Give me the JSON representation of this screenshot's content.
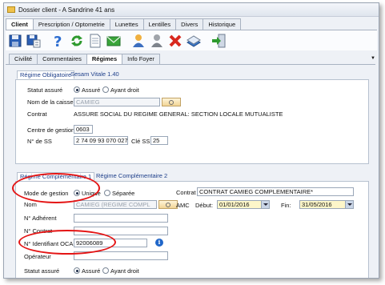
{
  "window": {
    "title": "Dossier client - A Sandrine 41 ans"
  },
  "main_tabs": [
    "Client",
    "Prescription / Optometrie",
    "Lunettes",
    "Lentilles",
    "Divers",
    "Historique"
  ],
  "toolbar": {
    "icons": [
      "save-icon",
      "save-as-icon",
      "help-icon",
      "refresh-icon",
      "document-icon",
      "email-icon",
      "user-icon",
      "user-grey-icon",
      "delete-icon",
      "book-icon",
      "exit-icon"
    ]
  },
  "sub_tabs": [
    "Civilité",
    "Commentaires",
    "Régimes",
    "Info Foyer"
  ],
  "panel1": {
    "tabs": [
      "Régime Obligatoire",
      "Sesam Vitale 1.40"
    ],
    "statut_label": "Statut assuré",
    "statut_options": [
      "Assuré",
      "Ayant droit"
    ],
    "caisse_label": "Nom de la caisse",
    "caisse_value": "CAMIEG",
    "contrat_label": "Contrat",
    "contrat_value": "ASSURE SOCIAL DU REGIME GENERAL: SECTION LOCALE MUTUALISTE",
    "centre_label": "Centre de gestion",
    "centre_value": "0603",
    "ss_label": "N° de SS",
    "ss_value": "2 74 09 93 070 027",
    "cle_label": "Clé SS",
    "cle_value": "25"
  },
  "panel2": {
    "tabs": [
      "Régime Complémentaire 1",
      "Régime Complémentaire 2"
    ],
    "mode_label": "Mode de gestion",
    "mode_options": [
      "Unique",
      "Séparée"
    ],
    "nom_label": "Nom",
    "nom_value": "CAMIEG (REGIME COMPL",
    "adherent_label": "N° Adhérent",
    "ncontrat_label": "N° Contrat",
    "ocam_label": "N° Identifiant OCAM",
    "ocam_value": "92006089",
    "operateur_label": "Opérateur",
    "statut_label": "Statut assuré",
    "statut_options": [
      "Assuré",
      "Ayant droit"
    ],
    "contrat_label": "Contrat",
    "contrat_value": "CONTRAT CAMIEG COMPLEMENTAIRE*",
    "amc_label": "AMC",
    "debut_label": "Début:",
    "debut_value": "01/01/2016",
    "fin_label": "Fin:",
    "fin_value": "31/05/2016"
  },
  "colors": {
    "annotation": "#e41414",
    "accent": "#1f66c9",
    "combo_bg": "#fdf6c9"
  }
}
